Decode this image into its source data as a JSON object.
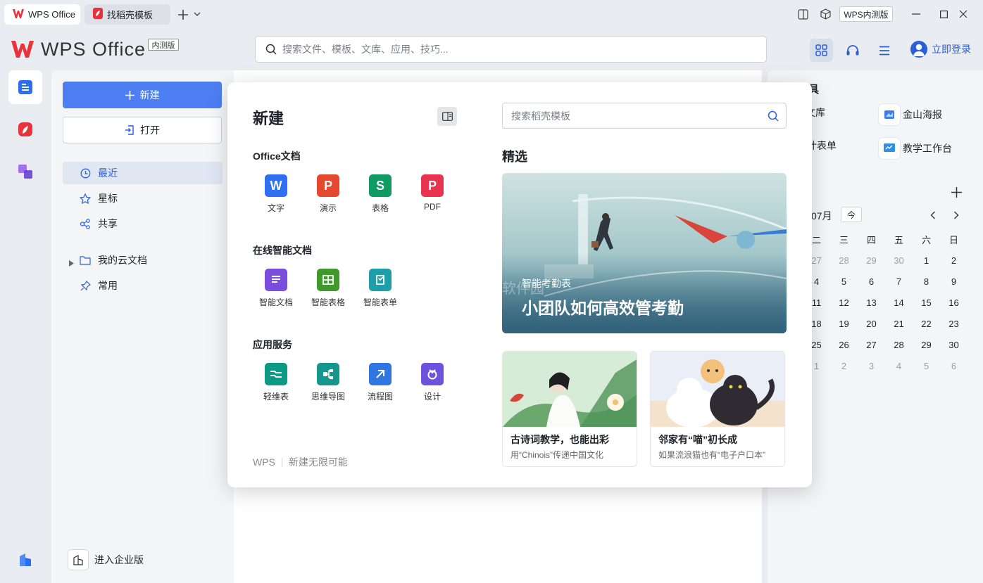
{
  "tabs": [
    {
      "label": "WPS Office"
    },
    {
      "label": "找稻壳模板"
    }
  ],
  "titlebar": {
    "badge": "WPS内测版"
  },
  "header": {
    "logo_text": "WPS Office",
    "logo_badge": "内测版",
    "search_placeholder": "搜索文件、模板、文库、应用、技巧...",
    "login_label": "立即登录"
  },
  "sidebar": {
    "new_label": "新建",
    "open_label": "打开",
    "items": [
      {
        "label": "最近"
      },
      {
        "label": "星标"
      },
      {
        "label": "共享"
      },
      {
        "label": "我的云文档"
      },
      {
        "label": "常用"
      }
    ],
    "enterprise_label": "进入企业版"
  },
  "right_panel": {
    "tools_title_partial": "具",
    "apps": [
      {
        "label": "文库"
      },
      {
        "label": "金山海报"
      },
      {
        "label": "计表单"
      },
      {
        "label": "教学工作台"
      }
    ],
    "calendar": {
      "month_label": "07月",
      "today_label": "今",
      "weekdays": [
        "二",
        "三",
        "四",
        "五",
        "六",
        "日"
      ],
      "weeks": [
        [
          "27",
          "28",
          "29",
          "30",
          "1",
          "2"
        ],
        [
          "4",
          "5",
          "6",
          "7",
          "8",
          "9"
        ],
        [
          "11",
          "12",
          "13",
          "14",
          "15",
          "16"
        ],
        [
          "18",
          "19",
          "20",
          "21",
          "22",
          "23"
        ],
        [
          "25",
          "26",
          "27",
          "28",
          "29",
          "30"
        ],
        [
          "1",
          "2",
          "3",
          "4",
          "5",
          "6"
        ]
      ]
    }
  },
  "modal": {
    "title": "新建",
    "sections": [
      {
        "title": "Office文档",
        "apps": [
          {
            "label": "文字",
            "glyph": "W",
            "color": "#2f6ff2"
          },
          {
            "label": "演示",
            "glyph": "P",
            "color": "#e4482e"
          },
          {
            "label": "表格",
            "glyph": "S",
            "color": "#0f9b64"
          },
          {
            "label": "PDF",
            "glyph": "P",
            "color": "#e9344f"
          }
        ]
      },
      {
        "title": "在线智能文档",
        "apps": [
          {
            "label": "智能文档",
            "color": "#7a4ddf"
          },
          {
            "label": "智能表格",
            "color": "#3f9a2b"
          },
          {
            "label": "智能表单",
            "color": "#1e9ea8"
          }
        ]
      },
      {
        "title": "应用服务",
        "apps": [
          {
            "label": "轻维表",
            "color": "#0d9a84"
          },
          {
            "label": "思维导图",
            "color": "#17968e"
          },
          {
            "label": "流程图",
            "color": "#2f76e1"
          },
          {
            "label": "设计",
            "color": "#6d52de"
          }
        ]
      }
    ],
    "footer_brand": "WPS",
    "footer_slogan": "新建无限可能",
    "template_search_placeholder": "搜索稻壳模板",
    "featured_title": "精选",
    "banner": {
      "subtitle": "智能考勤表",
      "title": "小团队如何高效管考勤",
      "watermark": "软件园"
    },
    "cards": [
      {
        "title": "古诗词教学，也能出彩",
        "subtitle": "用“Chinois”传递中国文化"
      },
      {
        "title": "邻家有“喵”初长成",
        "subtitle": "如果流浪猫也有“电子户口本”"
      }
    ]
  }
}
